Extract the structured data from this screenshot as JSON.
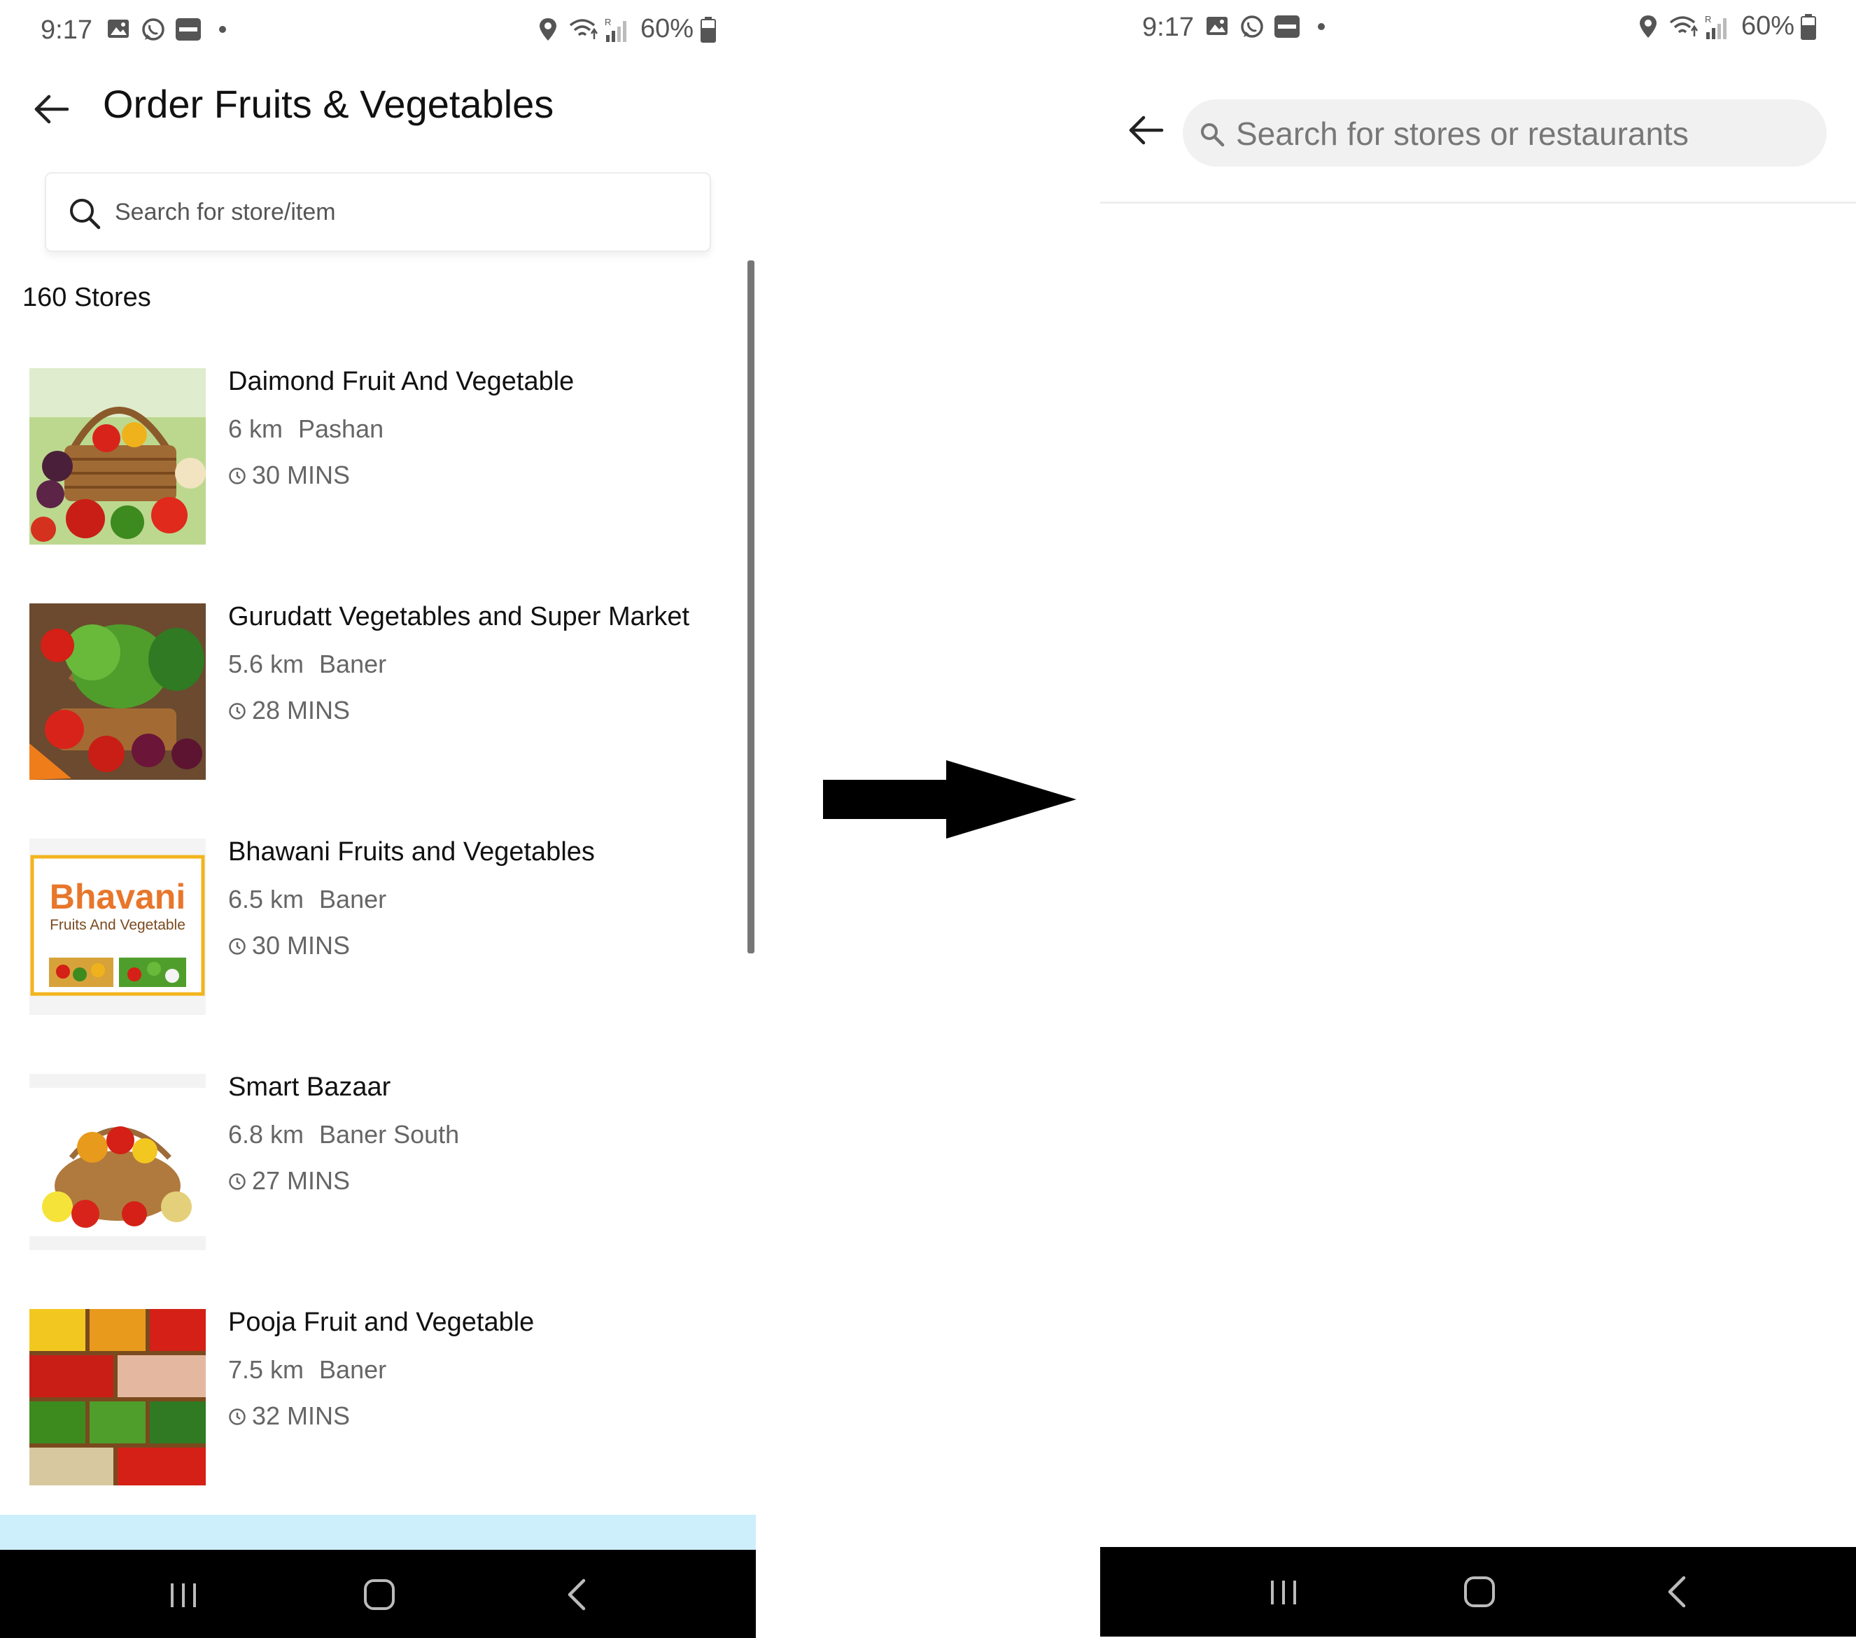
{
  "left_screen": {
    "status_bar": {
      "time": "9:17",
      "battery": "60%",
      "icons": [
        "gallery-icon",
        "whatsapp-icon",
        "paytm-icon",
        "dot-icon",
        "location-icon",
        "wifi-icon",
        "signal-icon",
        "battery-icon"
      ]
    },
    "header": {
      "title": "Order Fruits & Vegetables"
    },
    "search": {
      "placeholder": "Search for store/item"
    },
    "store_count": "160 Stores",
    "stores": [
      {
        "name": "Daimond Fruit And Vegetable",
        "distance": "6 km",
        "area": "Pashan",
        "eta": "30 MINS"
      },
      {
        "name": "Gurudatt Vegetables and Super Market",
        "distance": "5.6 km",
        "area": "Baner",
        "eta": "28 MINS"
      },
      {
        "name": "Bhawani Fruits and Vegetables",
        "distance": "6.5 km",
        "area": "Baner",
        "eta": "30 MINS",
        "logo_text": "Bhavani",
        "logo_subtext": "Fruits And Vegetable"
      },
      {
        "name": "Smart Bazaar",
        "distance": "6.8 km",
        "area": "Baner South",
        "eta": "27 MINS"
      },
      {
        "name": "Pooja Fruit and Vegetable",
        "distance": "7.5 km",
        "area": "Baner",
        "eta": "32 MINS"
      }
    ],
    "nav_bar": [
      "recents-icon",
      "home-icon",
      "back-icon"
    ]
  },
  "right_screen": {
    "status_bar": {
      "time": "9:17",
      "battery": "60%"
    },
    "search": {
      "placeholder": "Search for stores or restaurants"
    },
    "nav_bar": [
      "recents-icon",
      "home-icon",
      "back-icon"
    ]
  },
  "colors": {
    "background": "#ffffff",
    "nav_bar": "#000000",
    "secondary_text": "#666666",
    "search_pill": "#f1f1f1",
    "peek_banner": "#cdeefb",
    "logo_orange": "#e8762b",
    "logo_border": "#f2b51e"
  }
}
